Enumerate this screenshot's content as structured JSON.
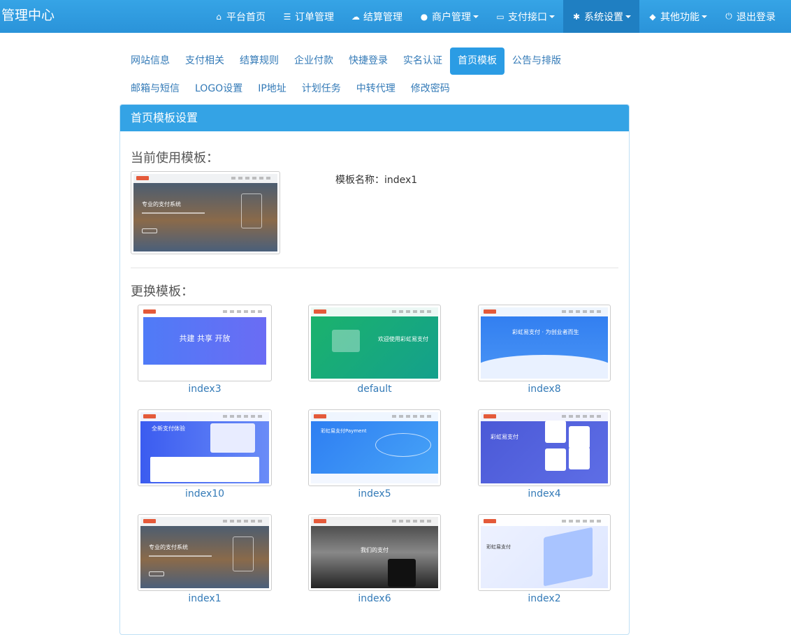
{
  "header": {
    "brand": "管理中心",
    "nav": [
      {
        "label": "平台首页",
        "icon": "home-icon",
        "glyph": "⌂",
        "dropdown": false,
        "active": false
      },
      {
        "label": "订单管理",
        "icon": "list-icon",
        "glyph": "☰",
        "dropdown": false,
        "active": false
      },
      {
        "label": "结算管理",
        "icon": "cloud-icon",
        "glyph": "☁",
        "dropdown": false,
        "active": false
      },
      {
        "label": "商户管理",
        "icon": "user-icon",
        "glyph": "●",
        "dropdown": true,
        "active": false
      },
      {
        "label": "支付接口",
        "icon": "credit-card-icon",
        "glyph": "▭",
        "dropdown": true,
        "active": false
      },
      {
        "label": "系统设置",
        "icon": "gear-icon",
        "glyph": "✱",
        "dropdown": true,
        "active": true
      },
      {
        "label": "其他功能",
        "icon": "cube-icon",
        "glyph": "◆",
        "dropdown": true,
        "active": false
      },
      {
        "label": "退出登录",
        "icon": "power-icon",
        "glyph": "⏻",
        "dropdown": false,
        "active": false
      }
    ]
  },
  "tabs": {
    "row1": [
      "网站信息",
      "支付相关",
      "结算规则",
      "企业付款",
      "快捷登录",
      "实名认证",
      "首页模板",
      "公告与排版"
    ],
    "row2": [
      "邮箱与短信",
      "LOGO设置",
      "IP地址",
      "计划任务",
      "中转代理",
      "修改密码"
    ],
    "active": "首页模板"
  },
  "panel": {
    "title": "首页模板设置",
    "current_label": "当前使用模板：",
    "template_name_line": "模板名称：index1",
    "change_label": "更换模板："
  },
  "templates": [
    {
      "name": "index3",
      "theme": "banner-blue",
      "headline": "共建  共享  开放"
    },
    {
      "name": "default",
      "theme": "green",
      "headline": "欢迎使用彩虹易支付"
    },
    {
      "name": "index8",
      "theme": "wave-blue",
      "headline": "彩虹易支付 · 为创业者而生"
    },
    {
      "name": "index10",
      "theme": "laptop",
      "headline": "全新支付体验"
    },
    {
      "name": "index5",
      "theme": "orbit-blue",
      "headline": "彩虹易支付Payment"
    },
    {
      "name": "index4",
      "theme": "indigo-cards",
      "headline": "彩虹易支付"
    },
    {
      "name": "index1",
      "theme": "city",
      "headline": "专业的支付系统"
    },
    {
      "name": "index6",
      "theme": "bw-city",
      "headline": "我们的支付"
    },
    {
      "name": "index2",
      "theme": "iso-server",
      "headline": "彩虹易支付"
    }
  ],
  "current_template": {
    "theme": "city",
    "headline": "专业的支付系统"
  },
  "colors": {
    "nav": "#2a93d9",
    "nav_active": "#1f7fc2",
    "panel_heading": "#34a3e5",
    "link": "#337ab7"
  }
}
